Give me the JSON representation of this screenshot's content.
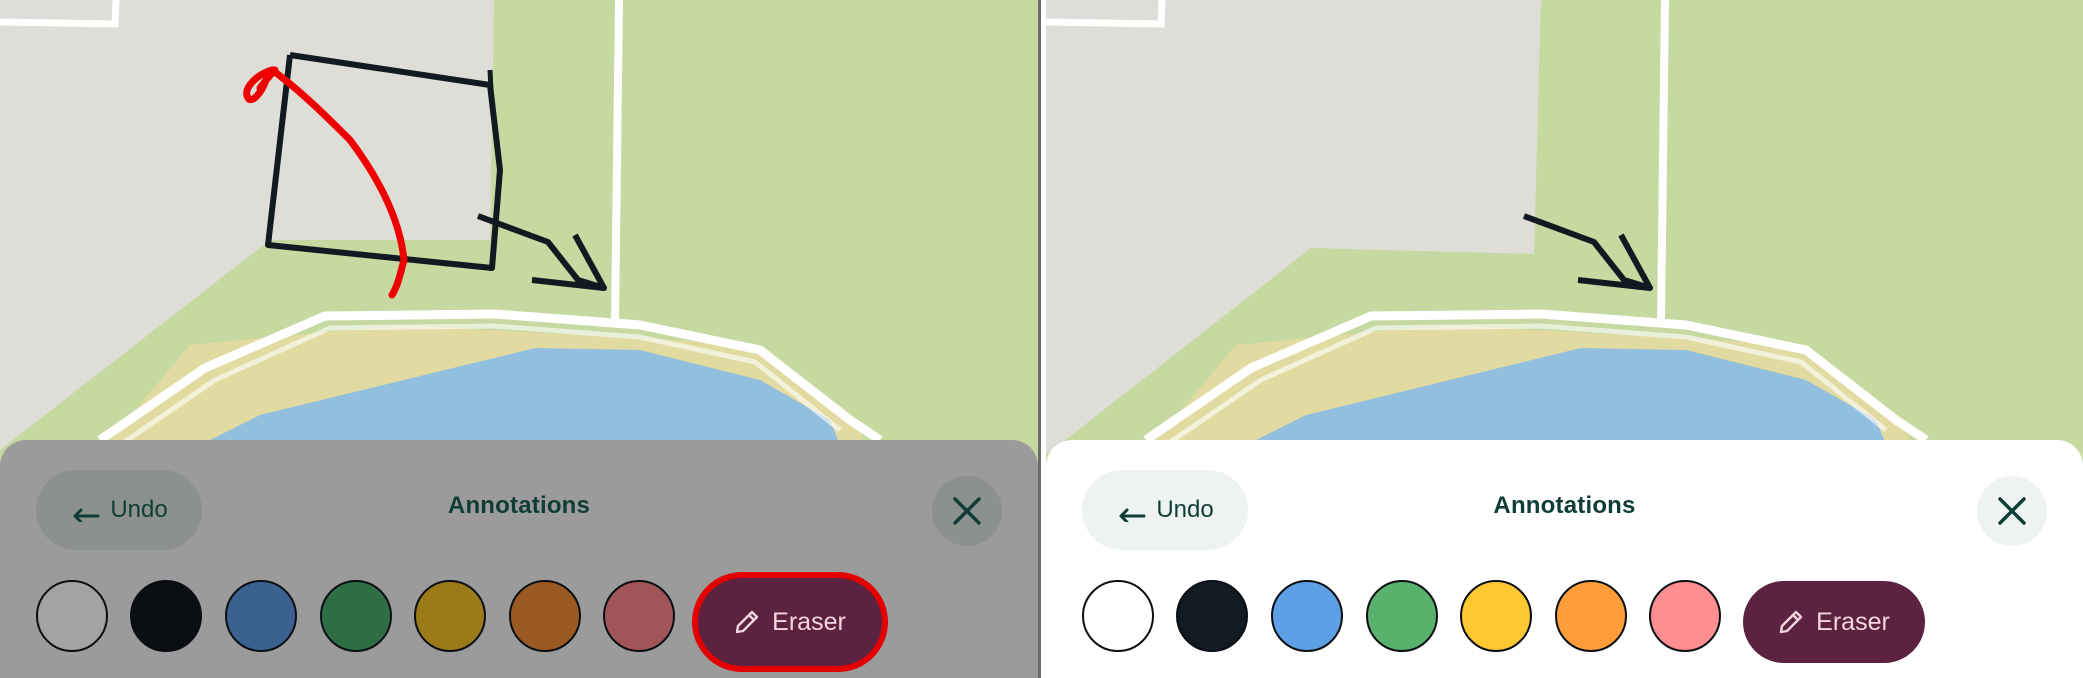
{
  "left_panel": {
    "undo_label": "Undo",
    "title": "Annotations",
    "eraser_label": "Eraser",
    "swatches": [
      "#a3a3a3",
      "#0b0e13",
      "#3b6191",
      "#2f6e45",
      "#9b7a1a",
      "#9a5b22",
      "#a05558"
    ],
    "sheet_color": "#9b9b9b",
    "highlight_color": "#e40000"
  },
  "right_panel": {
    "undo_label": "Undo",
    "title": "Annotations",
    "eraser_label": "Eraser",
    "swatches": [
      "#ffffff",
      "#121a22",
      "#5ea0e6",
      "#58b26b",
      "#fdc731",
      "#ff9d3a",
      "#ff8e91"
    ],
    "sheet_color": "#ffffff"
  },
  "icons": {
    "undo": "undo-arrow-icon",
    "close": "close-icon",
    "eraser": "pencil-icon"
  },
  "map_colors": {
    "land": "#dfddd7",
    "park": "#c5d9a0",
    "sand": "#e2dba1",
    "water": "#93bfde",
    "road": "#ffffff",
    "red_stroke": "#ee0000",
    "black_stroke": "#111a20"
  }
}
